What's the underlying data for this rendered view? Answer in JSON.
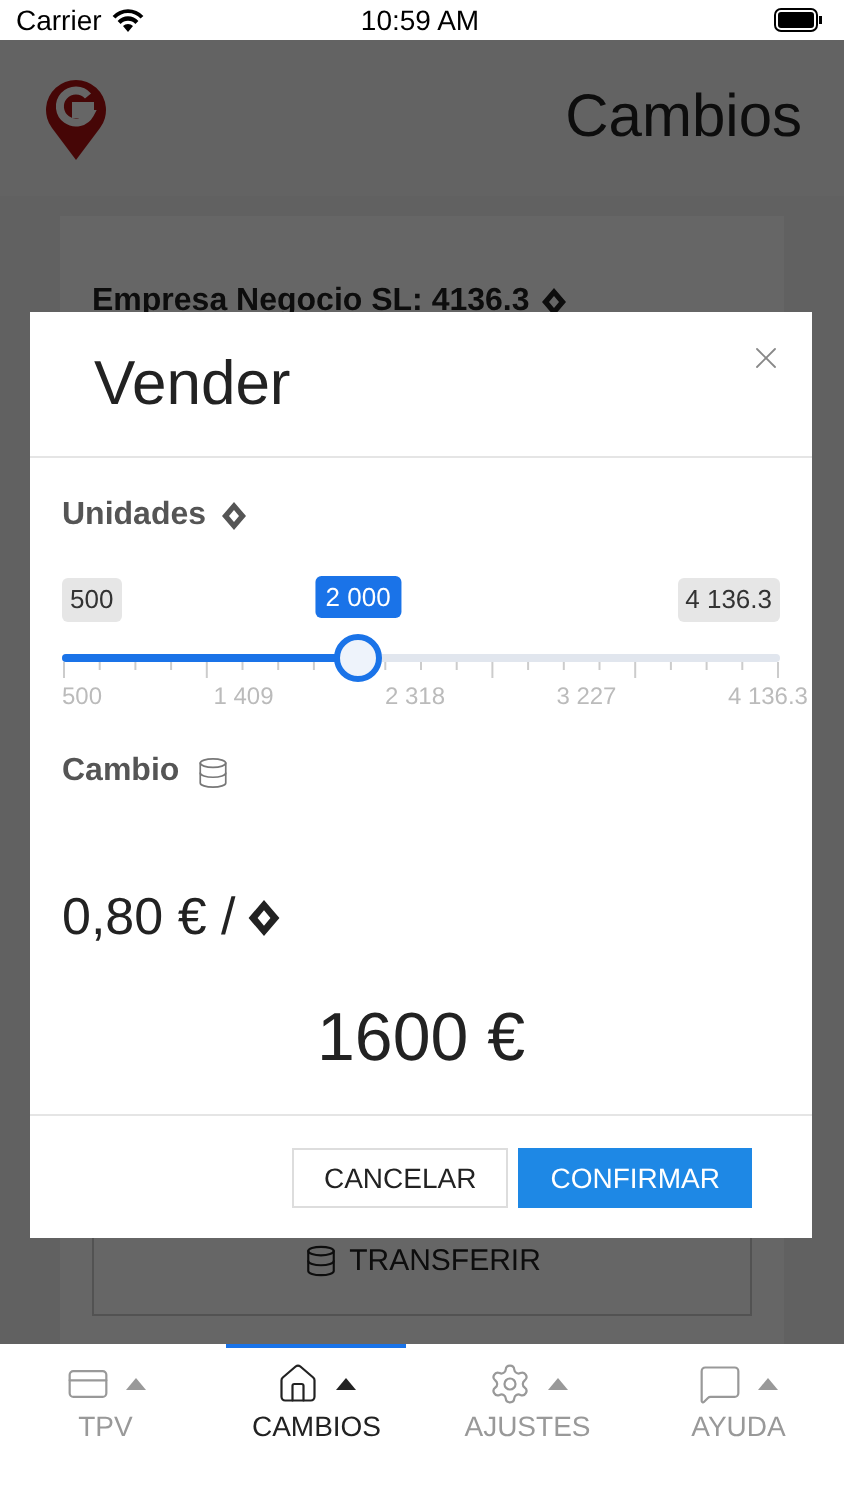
{
  "status_bar": {
    "carrier": "Carrier",
    "time": "10:59 AM"
  },
  "header": {
    "title": "Cambios"
  },
  "account": {
    "label": "Empresa Negocio SL: 4136.3"
  },
  "transfer_button": {
    "label": "TRANSFERIR"
  },
  "dialog": {
    "title": "Vender",
    "units": {
      "label": "Unidades",
      "min": "500",
      "max": "4 136.3",
      "value": "2 000",
      "level": 0.4125,
      "ticks": [
        "500",
        "1 409",
        "2 318",
        "3 227",
        "4 136.3"
      ]
    },
    "exchange": {
      "label": "Cambio",
      "rate": "0,80 € /",
      "total": "1600 €"
    },
    "buttons": [
      {
        "label": "CANCELAR",
        "kind": "secondary"
      },
      {
        "label": "CONFIRMAR",
        "kind": "primary"
      }
    ]
  },
  "tabs": [
    {
      "label": "TPV",
      "kind": "card",
      "selected": false
    },
    {
      "label": "CAMBIOS",
      "kind": "home",
      "selected": true
    },
    {
      "label": "AJUSTES",
      "kind": "gear",
      "selected": false
    },
    {
      "label": "AYUDA",
      "kind": "chat",
      "selected": false
    }
  ]
}
